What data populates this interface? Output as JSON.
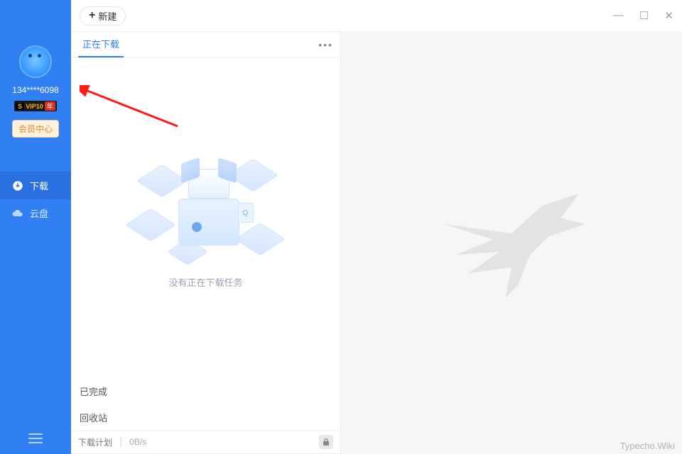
{
  "sidebar": {
    "username": "134****6098",
    "vip": {
      "s": "S",
      "label": "VIP10",
      "suffix": "年"
    },
    "member_button": "会员中心",
    "nav": {
      "download": "下载",
      "cloud": "云盘"
    }
  },
  "topbar": {
    "new_button": "新建"
  },
  "main": {
    "tab_downloading": "正在下载",
    "empty_text": "没有正在下载任务",
    "section_completed": "已完成",
    "section_recycle": "回收站",
    "status": {
      "plan_label": "下载计划",
      "speed": "0B/s"
    }
  },
  "watermark": "Typecho.Wiki"
}
